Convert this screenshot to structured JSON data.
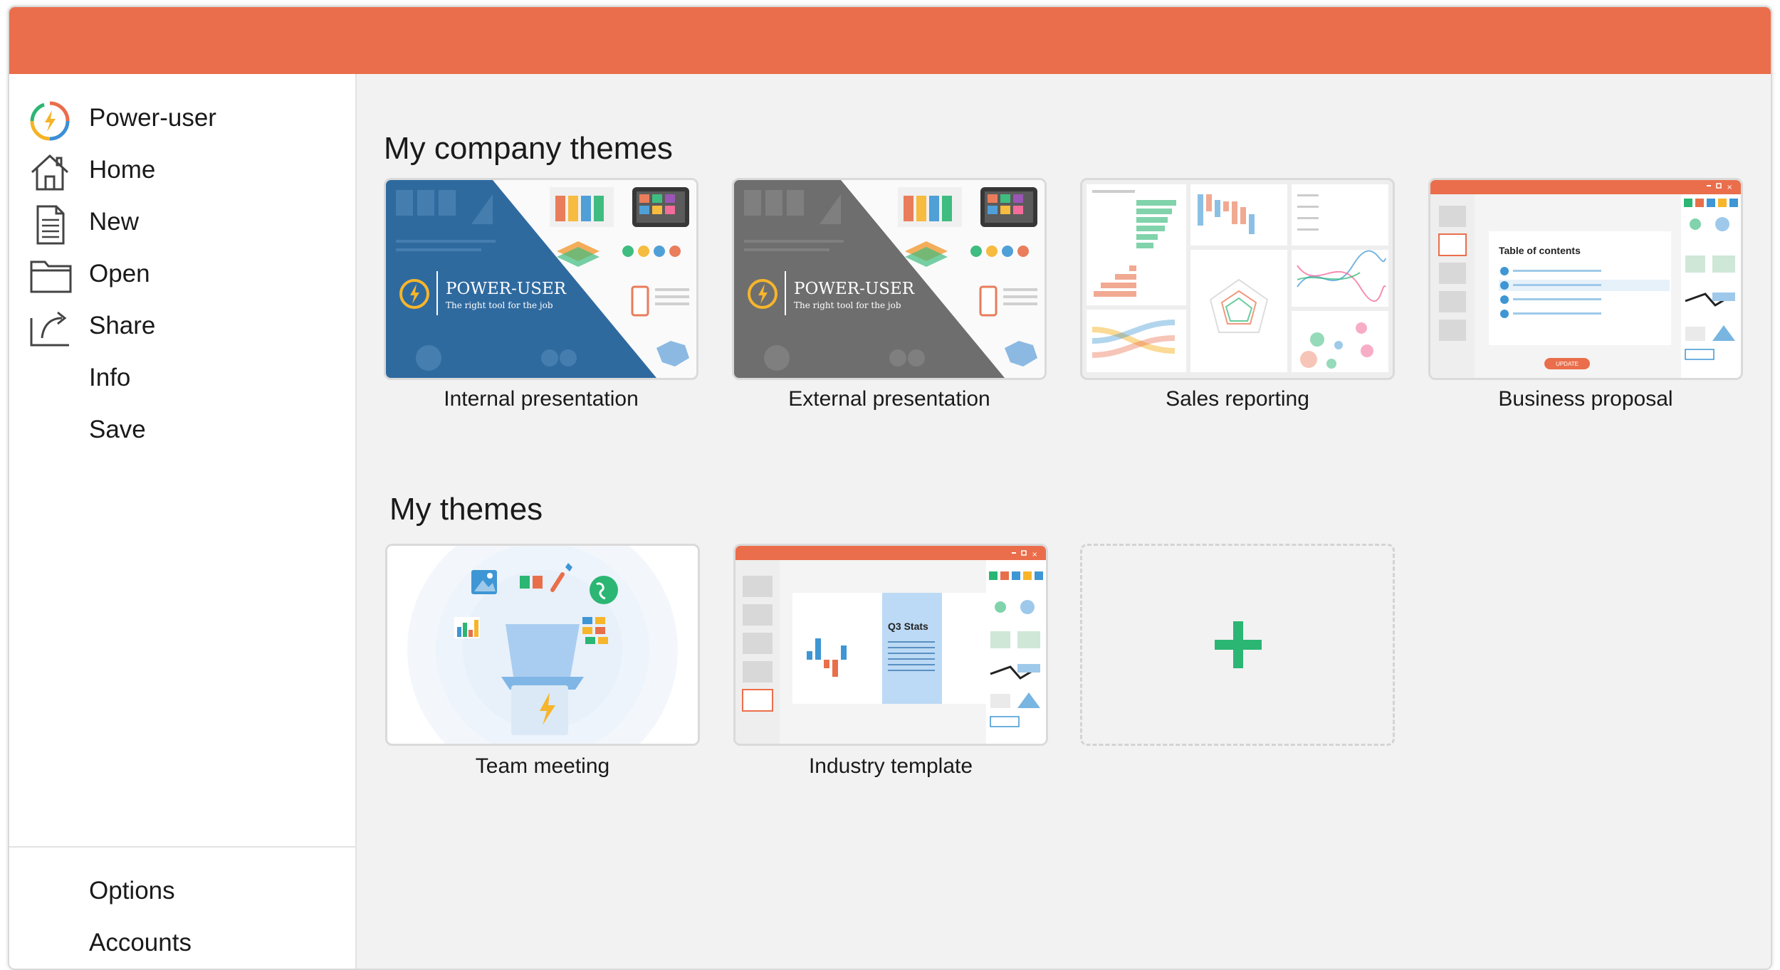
{
  "app": {
    "name": "Power-user",
    "accent_color": "#ea6e4b"
  },
  "sidebar": {
    "items": [
      {
        "label": "Home",
        "icon": "home-icon"
      },
      {
        "label": "New",
        "icon": "document-icon"
      },
      {
        "label": "Open",
        "icon": "folder-icon"
      },
      {
        "label": "Share",
        "icon": "share-icon"
      },
      {
        "label": "Info"
      },
      {
        "label": "Save"
      }
    ],
    "bottom_items": [
      {
        "label": "Options"
      },
      {
        "label": "Accounts"
      }
    ]
  },
  "company_themes": {
    "heading": "My company themes",
    "tiles": [
      {
        "label": "Internal presentation",
        "thumb_title": "POWER-USER",
        "thumb_subtitle": "The right tool for the job",
        "overlay_color": "#2f6a9f"
      },
      {
        "label": "External presentation",
        "thumb_title": "POWER-USER",
        "thumb_subtitle": "The right tool for the job",
        "overlay_color": "#6e6e6e"
      },
      {
        "label": "Sales reporting"
      },
      {
        "label": "Business proposal",
        "thumb_heading": "Table of contents",
        "thumb_button": "UPDATE"
      }
    ]
  },
  "my_themes": {
    "heading": "My themes",
    "tiles": [
      {
        "label": "Team meeting"
      },
      {
        "label": "Industry template",
        "thumb_heading": "Q3 Stats"
      }
    ],
    "add_tile": {
      "icon": "plus-icon",
      "color": "#2bb673"
    }
  }
}
